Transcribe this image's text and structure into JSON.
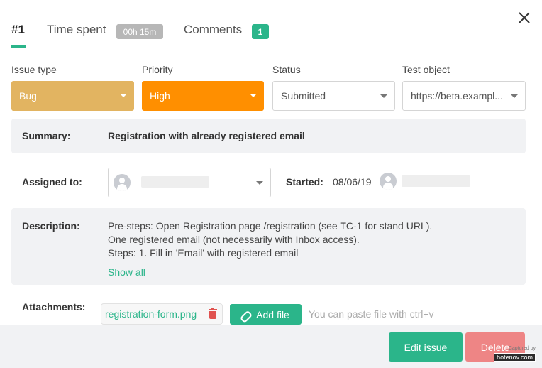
{
  "tabs": {
    "issue": {
      "label": "#1"
    },
    "time_spent": {
      "label": "Time spent",
      "badge": "00h 15m"
    },
    "comments": {
      "label": "Comments",
      "badge": "1"
    }
  },
  "fields": {
    "issue_type": {
      "label": "Issue type",
      "value": "Bug",
      "color": "#e2b461"
    },
    "priority": {
      "label": "Priority",
      "value": "High",
      "color": "#ff8f00"
    },
    "status": {
      "label": "Status",
      "value": "Submitted"
    },
    "test_object": {
      "label": "Test object",
      "value": "https://beta.exampl..."
    }
  },
  "summary": {
    "label": "Summary:",
    "text": "Registration with already registered email"
  },
  "assigned": {
    "label": "Assigned to:",
    "value": ""
  },
  "started": {
    "label": "Started:",
    "date": "08/06/19"
  },
  "description": {
    "label": "Description:",
    "lines": [
      "Pre-steps: Open Registration page /registration (see TC-1 for stand URL).",
      "One registered email (not necessarily with Inbox access).",
      "Steps: 1. Fill in 'Email' with registered email"
    ],
    "show_all": "Show all"
  },
  "attachments": {
    "label": "Attachments:",
    "files": [
      "registration-form.png"
    ],
    "add_label": "Add file",
    "hint": "You can paste file with ctrl+v"
  },
  "footer": {
    "edit_label": "Edit issue",
    "delete_label": "Delete"
  },
  "watermark": {
    "line1": "Captured by",
    "line2": "hotenov.com"
  },
  "icons": [
    "close-icon",
    "chevron-down-icon",
    "user-avatar-icon",
    "trash-icon",
    "paperclip-icon"
  ]
}
